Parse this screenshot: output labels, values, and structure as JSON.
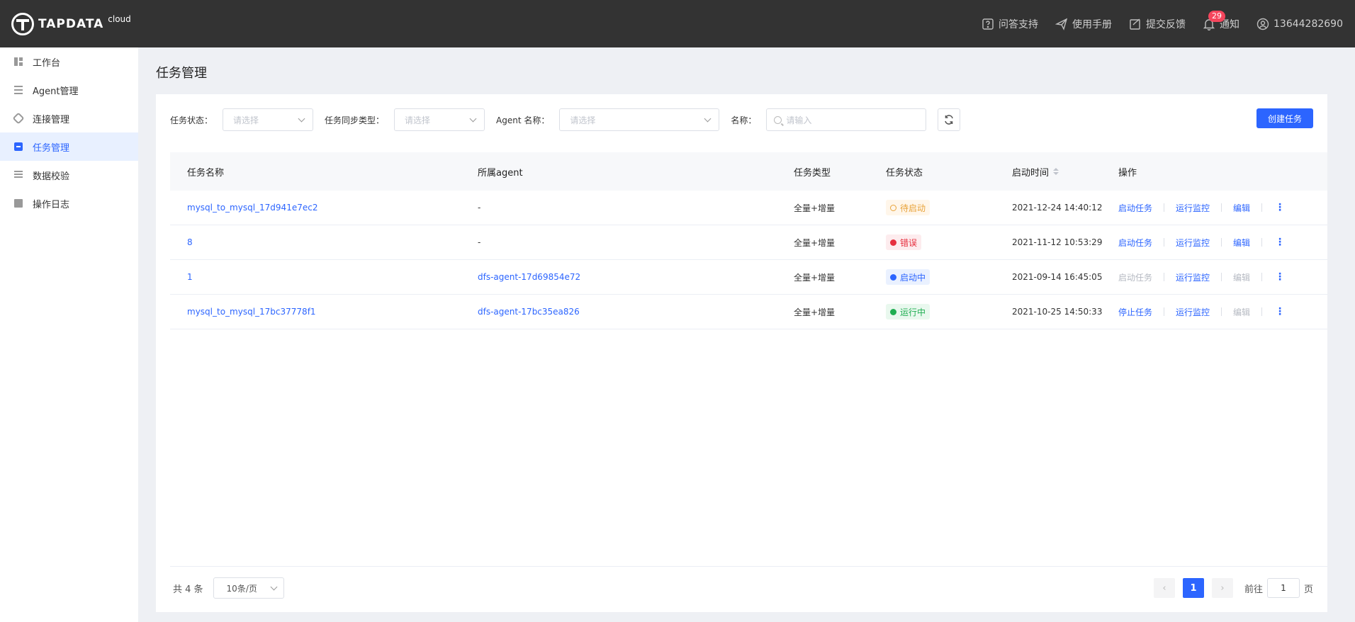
{
  "header": {
    "brand": "TAPDATA",
    "brand_suffix": "cloud",
    "items": [
      {
        "label": "问答支持",
        "icon": "help-icon"
      },
      {
        "label": "使用手册",
        "icon": "send-icon"
      },
      {
        "label": "提交反馈",
        "icon": "feedback-icon"
      },
      {
        "label": "通知",
        "icon": "bell-icon",
        "badge": "29"
      },
      {
        "label": "13644282690",
        "icon": "user-icon"
      }
    ]
  },
  "sidebar": {
    "items": [
      {
        "label": "工作台",
        "icon": "dashboard-icon"
      },
      {
        "label": "Agent管理",
        "icon": "agent-icon"
      },
      {
        "label": "连接管理",
        "icon": "link-icon"
      },
      {
        "label": "任务管理",
        "icon": "task-icon",
        "active": true
      },
      {
        "label": "数据校验",
        "icon": "verify-icon"
      },
      {
        "label": "操作日志",
        "icon": "log-icon"
      }
    ]
  },
  "page": {
    "title": "任务管理"
  },
  "filters": {
    "status_label": "任务状态：",
    "status_placeholder": "请选择",
    "sync_label": "任务同步类型：",
    "sync_placeholder": "请选择",
    "agent_label": "Agent 名称：",
    "agent_placeholder": "请选择",
    "name_label": "名称：",
    "name_placeholder": "请输入",
    "create_label": "创建任务"
  },
  "table": {
    "headers": [
      "任务名称",
      "所属agent",
      "任务类型",
      "任务状态",
      "启动时间",
      "操作"
    ],
    "rows": [
      {
        "name": "mysql_to_mysql_17d941e7ec2",
        "agent": "-",
        "type": "全量+增量",
        "status": "待启动",
        "status_kind": "wait",
        "time": "2021-12-24 14:40:12",
        "op1": "启动任务",
        "op1_disabled": false,
        "op2": "运行监控",
        "op3": "编辑",
        "op3_disabled": false
      },
      {
        "name": "8",
        "agent": "-",
        "type": "全量+增量",
        "status": "错误",
        "status_kind": "err",
        "time": "2021-11-12 10:53:29",
        "op1": "启动任务",
        "op1_disabled": false,
        "op2": "运行监控",
        "op3": "编辑",
        "op3_disabled": false
      },
      {
        "name": "1",
        "agent": "dfs-agent-17d69854e72",
        "type": "全量+增量",
        "status": "启动中",
        "status_kind": "start",
        "time": "2021-09-14 16:45:05",
        "op1": "启动任务",
        "op1_disabled": true,
        "op2": "运行监控",
        "op3": "编辑",
        "op3_disabled": true
      },
      {
        "name": "mysql_to_mysql_17bc37778f1",
        "agent": "dfs-agent-17bc35ea826",
        "type": "全量+增量",
        "status": "运行中",
        "status_kind": "run",
        "time": "2021-10-25 14:50:33",
        "op1": "停止任务",
        "op1_disabled": false,
        "op2": "运行监控",
        "op3": "编辑",
        "op3_disabled": true
      }
    ]
  },
  "pagination": {
    "total": "共 4 条",
    "page_size": "10条/页",
    "current_page": "1",
    "goto_prefix": "前往",
    "goto_value": "1",
    "goto_suffix": "页"
  },
  "colors": {
    "accent": "#2c65ff",
    "header_bg": "#333333"
  }
}
